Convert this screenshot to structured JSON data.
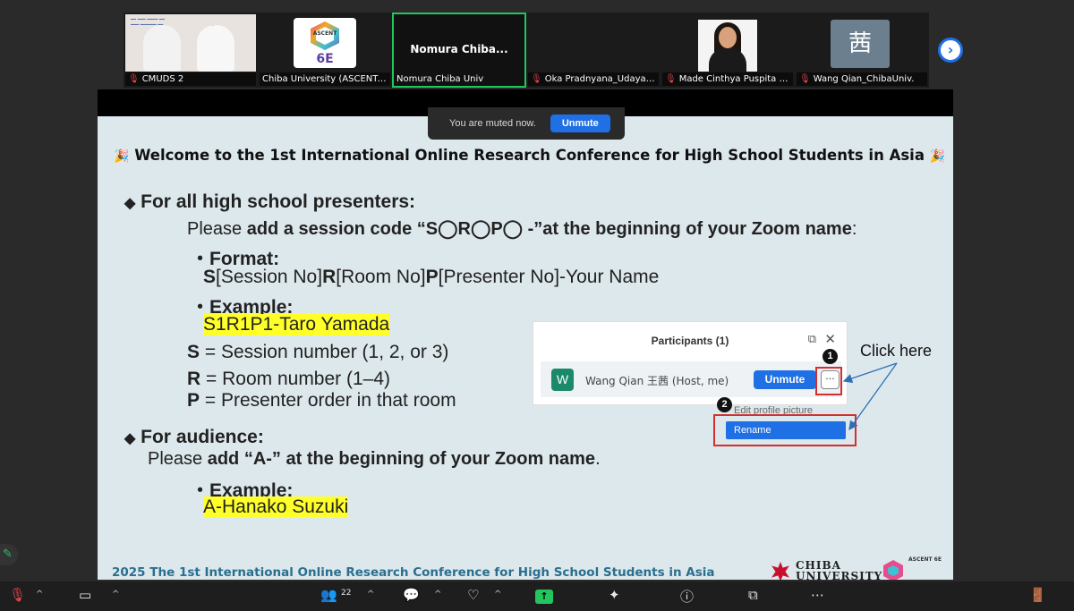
{
  "gallery": {
    "tiles": [
      {
        "name": "CMUDS 2",
        "muted": true,
        "kind": "video"
      },
      {
        "name": "Chiba University (ASCENT-6...",
        "muted": false,
        "kind": "logo"
      },
      {
        "name": "Nomura Chiba Univ",
        "muted": false,
        "kind": "speaker",
        "display_name": "Nomura  Chiba..."
      },
      {
        "name": "Oka Pradnyana_Udayan...",
        "muted": true,
        "kind": "blank"
      },
      {
        "name": "Made Cinthya Puspita S...",
        "muted": true,
        "kind": "portrait"
      },
      {
        "name": "Wang Qian_ChibaUniv.",
        "muted": true,
        "kind": "avatar",
        "avatar_char": "茜"
      }
    ],
    "logo_text_top": "ASCENT",
    "logo_text_bottom": "6E"
  },
  "mute_notice": {
    "text": "You are muted now.",
    "button": "Unmute"
  },
  "slide": {
    "title": "Welcome to the 1st International Online Research Conference for High School Students in Asia",
    "presenters_heading": "For all high school presenters:",
    "instruction_pre": "Please ",
    "instruction_bold": "add a session code “S◯R◯P◯ -”at the beginning of your Zoom name",
    "instruction_post": ":",
    "format_label": "Format:",
    "format_parts": [
      "S",
      "[Session No]",
      "R",
      "[Room No]",
      "P",
      "[Presenter No]-Your Name"
    ],
    "example_label": "Example:",
    "example_value": "S1R1P1-Taro Yamada",
    "legend": [
      {
        "key": "S",
        "text": " = Session number (1, 2, or 3)"
      },
      {
        "key": "R",
        "text": " = Room number (1–4)"
      },
      {
        "key": "P",
        "text": " = Presenter order in that room"
      }
    ],
    "audience_heading": "For audience:",
    "audience_pre": "Please ",
    "audience_bold": "add “A-” at the beginning of your Zoom name",
    "audience_post": ".",
    "audience_example_label": "Example:",
    "audience_example_value": "A-Hanako Suzuki",
    "footer": "2025 The 1st International Online Research Conference for High School Students in Asia",
    "chiba_logo": "CHIBA UNIVERSITY",
    "ascent_logo": "ASCENT 6E"
  },
  "participants_panel": {
    "title": "Participants (1)",
    "avatar": "W",
    "name": "Wang Qian 王茜 (Host, me)",
    "unmute": "Unmute",
    "more": "···",
    "menu_edit": "Edit profile picture",
    "menu_rename": "Rename",
    "step1": "1",
    "step2": "2",
    "callout": "Click here"
  },
  "toolbar": {
    "participant_count": "22"
  }
}
